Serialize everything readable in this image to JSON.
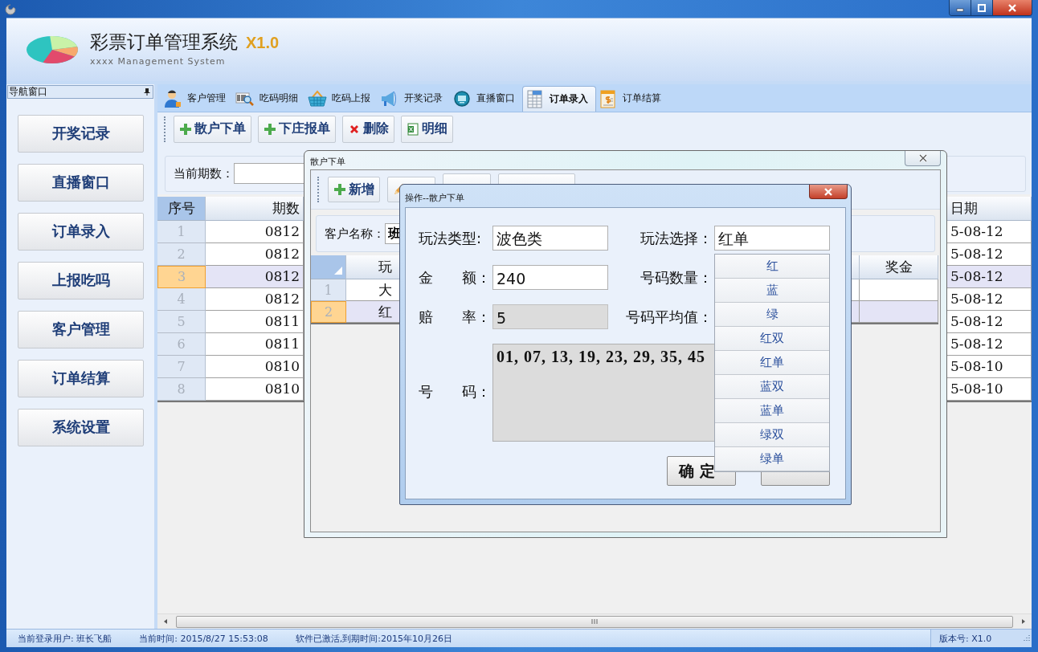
{
  "window": {
    "title": "彩票订单管理系统",
    "version": "X1.0",
    "subtitle": "xxxx Management System"
  },
  "navigation": {
    "title": "导航窗口",
    "items": [
      "开奖记录",
      "直播窗口",
      "订单录入",
      "上报吃吗",
      "客户管理",
      "订单结算",
      "系统设置"
    ]
  },
  "tabs": [
    {
      "label": "客户管理",
      "selected": false
    },
    {
      "label": "吃码明细",
      "selected": false
    },
    {
      "label": "吃码上报",
      "selected": false
    },
    {
      "label": "开奖记录",
      "selected": false
    },
    {
      "label": "直播窗口",
      "selected": false
    },
    {
      "label": "订单录入",
      "selected": true
    },
    {
      "label": "订单结算",
      "selected": false
    }
  ],
  "toolbar": [
    "散户下单",
    "下庄报单",
    "删除",
    "明细"
  ],
  "filter": {
    "label": "当前期数："
  },
  "table": {
    "columns": [
      "序号",
      "期数",
      "日期"
    ],
    "rows": [
      {
        "index": "1",
        "period": "0812",
        "date": "5-08-12",
        "selected": false
      },
      {
        "index": "2",
        "period": "0812",
        "date": "5-08-12",
        "selected": false
      },
      {
        "index": "3",
        "period": "0812",
        "date": "5-08-12",
        "selected": true
      },
      {
        "index": "4",
        "period": "0812",
        "date": "5-08-12",
        "selected": false
      },
      {
        "index": "5",
        "period": "0811",
        "date": "5-08-12",
        "selected": false
      },
      {
        "index": "6",
        "period": "0811",
        "date": "5-08-12",
        "selected": false
      },
      {
        "index": "7",
        "period": "0810",
        "date": "5-08-10",
        "selected": false
      },
      {
        "index": "8",
        "period": "0810",
        "date": "5-08-10",
        "selected": false
      }
    ]
  },
  "order_window": {
    "title": "散户下单",
    "toolbar": [
      "新增"
    ],
    "customer": {
      "label": "客户名称：",
      "value": "班"
    },
    "table": {
      "columns": [
        "玩",
        "奖金"
      ],
      "rows": [
        {
          "index": "1",
          "play": "大",
          "selected": false
        },
        {
          "index": "2",
          "play": "红",
          "selected": true
        }
      ]
    }
  },
  "dialog": {
    "title": "操作--散户下单",
    "fields": [
      {
        "label": "玩法类型:",
        "value": "波色类",
        "disabled": false
      },
      {
        "label": "玩法选择：",
        "value": "红单",
        "disabled": false,
        "expanded": true,
        "options": [
          "红",
          "蓝",
          "绿",
          "红双",
          "红单",
          "蓝双",
          "蓝单",
          "绿双",
          "绿单"
        ]
      },
      {
        "label": "金　　额：",
        "value": "240",
        "disabled": false
      },
      {
        "label": "号码数量："
      },
      {
        "label": "赔　　率：",
        "value": "5",
        "disabled": true
      },
      {
        "label": "号码平均值："
      }
    ],
    "numbers": {
      "label": "号　　码：",
      "value": "01, 07, 13, 19, 23, 29, 35, 45"
    },
    "buttons": [
      "确 定"
    ]
  },
  "status_bar": {
    "items": [
      "当前登录用户: 班长飞船",
      "当前时间: 2015/8/27 15:53:08",
      "软件已激活,到期时间:2015年10月26日"
    ],
    "version": "版本号: X1.0"
  }
}
